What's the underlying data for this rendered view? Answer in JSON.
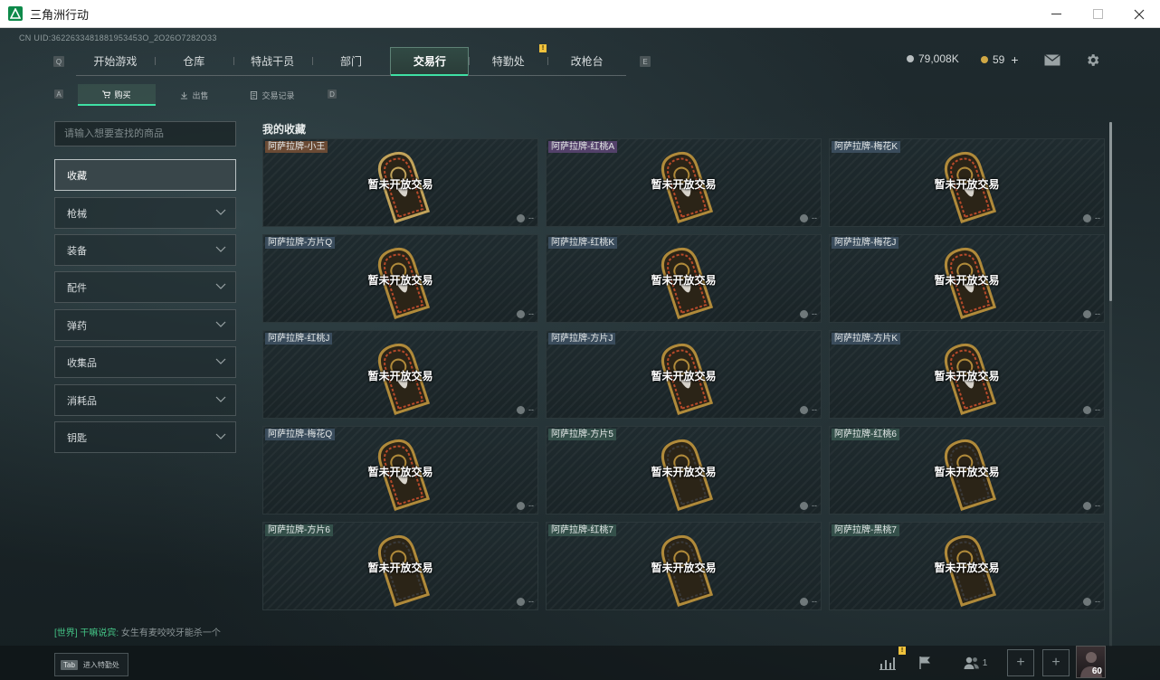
{
  "window": {
    "title": "三角洲行动"
  },
  "uid": "CN UID:3622633481881953453O_2O26O7282O33",
  "main_nav": {
    "key_left": "Q",
    "key_right": "E",
    "tabs": [
      {
        "label": "开始游戏"
      },
      {
        "label": "仓库"
      },
      {
        "label": "特战干员"
      },
      {
        "label": "部门"
      },
      {
        "label": "交易行",
        "active": true
      },
      {
        "label": "特勤处",
        "badge": "!"
      },
      {
        "label": "改枪台"
      }
    ]
  },
  "currency": {
    "silver": "79,008K",
    "gold": "59",
    "gold_add": "+"
  },
  "sub_nav": {
    "key_left": "A",
    "key_right": "D",
    "tabs": [
      {
        "label": "购买",
        "active": true
      },
      {
        "label": "出售"
      },
      {
        "label": "交易记录"
      }
    ]
  },
  "sidebar": {
    "search_placeholder": "请输入想要查找的商品",
    "categories": [
      {
        "label": "收藏",
        "active": true
      },
      {
        "label": "枪械"
      },
      {
        "label": "装备"
      },
      {
        "label": "配件"
      },
      {
        "label": "弹药"
      },
      {
        "label": "收集品"
      },
      {
        "label": "消耗品"
      },
      {
        "label": "钥匙"
      }
    ]
  },
  "content": {
    "title": "我的收藏",
    "status_text": "暂未开放交易",
    "price_text": "--",
    "items": [
      {
        "name": "阿萨拉牌-小王",
        "tag_color": "#6a4a34"
      },
      {
        "name": "阿萨拉牌-红桃A",
        "tag_color": "#53416a"
      },
      {
        "name": "阿萨拉牌-梅花K",
        "tag_color": "#3a4c5c"
      },
      {
        "name": "阿萨拉牌-方片Q",
        "tag_color": "#3a4c5c"
      },
      {
        "name": "阿萨拉牌-红桃K",
        "tag_color": "#3a4c5c"
      },
      {
        "name": "阿萨拉牌-梅花J",
        "tag_color": "#3a4c5c"
      },
      {
        "name": "阿萨拉牌-红桃J",
        "tag_color": "#3a4c5c"
      },
      {
        "name": "阿萨拉牌-方片J",
        "tag_color": "#3a4c5c"
      },
      {
        "name": "阿萨拉牌-方片K",
        "tag_color": "#3a4c5c"
      },
      {
        "name": "阿萨拉牌-梅花Q",
        "tag_color": "#3a4c5c"
      },
      {
        "name": "阿萨拉牌-方片5",
        "tag_color": "#34504a"
      },
      {
        "name": "阿萨拉牌-红桃6",
        "tag_color": "#34504a"
      },
      {
        "name": "阿萨拉牌-方片6",
        "tag_color": "#34504a"
      },
      {
        "name": "阿萨拉牌-红桃7",
        "tag_color": "#34504a"
      },
      {
        "name": "阿萨拉牌-黑桃7",
        "tag_color": "#34504a"
      }
    ]
  },
  "chat": {
    "channel": "[世界]",
    "user": "干嘛说宾:",
    "message": "女生有麦咬咬牙能杀一个"
  },
  "bottom": {
    "tab_key": "Tab",
    "tab_label": "进入特勤处",
    "stats_badge": "!",
    "friends_count": "1",
    "plus1": "+",
    "plus2": "+",
    "level": "60"
  },
  "colors": {
    "accent": "#3fe0a4",
    "badge": "#f0c23c"
  }
}
